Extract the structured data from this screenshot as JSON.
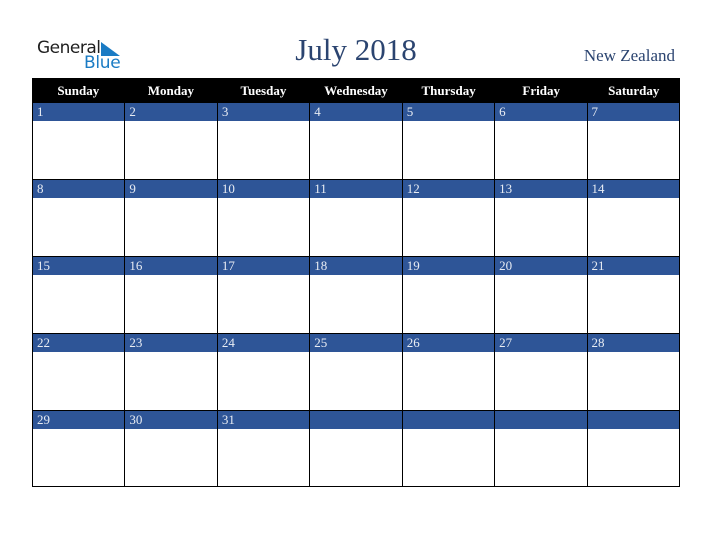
{
  "logo": {
    "line1": "General",
    "line2": "Blue",
    "icon": "triangle-flag-icon",
    "brand_color": "#1a7bc4"
  },
  "header": {
    "title": "July 2018",
    "country": "New Zealand",
    "title_color": "#2b4470"
  },
  "colors": {
    "header_bg": "#000000",
    "day_band": "#2e5597",
    "day_number": "#e8ecf3"
  },
  "calendar": {
    "weekdays": [
      "Sunday",
      "Monday",
      "Tuesday",
      "Wednesday",
      "Thursday",
      "Friday",
      "Saturday"
    ],
    "weeks": [
      [
        "1",
        "2",
        "3",
        "4",
        "5",
        "6",
        "7"
      ],
      [
        "8",
        "9",
        "10",
        "11",
        "12",
        "13",
        "14"
      ],
      [
        "15",
        "16",
        "17",
        "18",
        "19",
        "20",
        "21"
      ],
      [
        "22",
        "23",
        "24",
        "25",
        "26",
        "27",
        "28"
      ],
      [
        "29",
        "30",
        "31",
        "",
        "",
        "",
        ""
      ]
    ]
  }
}
